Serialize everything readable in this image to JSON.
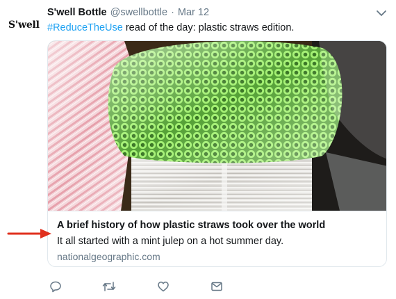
{
  "tweet": {
    "avatar_text": "S'well",
    "display_name": "S'well Bottle",
    "handle": "@swellbottle",
    "separator": "·",
    "date": "Mar 12",
    "hashtag": "#ReduceTheUse",
    "text_rest": " read of the day: plastic straws edition."
  },
  "card": {
    "title": "A brief history of how plastic straws took over the world",
    "description": "It all started with a mint julep on a hot summer day.",
    "domain": "nationalgeographic.com"
  },
  "actions": [
    {
      "icon": "reply-icon"
    },
    {
      "icon": "retweet-icon"
    },
    {
      "icon": "like-icon"
    },
    {
      "icon": "direct-message-icon"
    }
  ],
  "colors": {
    "link": "#1da1f2",
    "secondary_text": "#657786",
    "border": "#e1e8ed",
    "arrow": "#e0301e",
    "straw_green": "#8ee85a"
  }
}
